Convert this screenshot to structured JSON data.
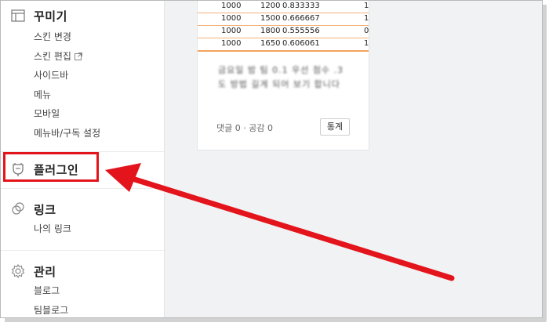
{
  "sidebar": {
    "decorate": {
      "title": "꾸미기",
      "items": [
        "스킨 변경",
        "스킨 편집",
        "사이드바",
        "메뉴",
        "모바일",
        "메뉴바/구독 설정"
      ]
    },
    "plugin": {
      "title": "플러그인"
    },
    "link": {
      "title": "링크",
      "items": [
        "나의 링크"
      ]
    },
    "manage": {
      "title": "관리",
      "items": [
        "블로그",
        "팀블로그"
      ]
    }
  },
  "post": {
    "table_rows": [
      [
        "1000",
        "1200",
        "0.833333",
        "1"
      ],
      [
        "1000",
        "1500",
        "0.666667",
        "1"
      ],
      [
        "1000",
        "1800",
        "0.555556",
        "0"
      ],
      [
        "1000",
        "1650",
        "0.606061",
        "1"
      ]
    ],
    "blurred_lines": [
      "금요일 밤 팀 0.1 우선 점수 .3",
      "도 방법 길게 되어 보기 합니다"
    ],
    "meta_text": "댓글 0 · 공감 0",
    "stats_button": "통계"
  },
  "colors": {
    "highlight": "#e3141b",
    "table_border": "#f2a35c"
  }
}
